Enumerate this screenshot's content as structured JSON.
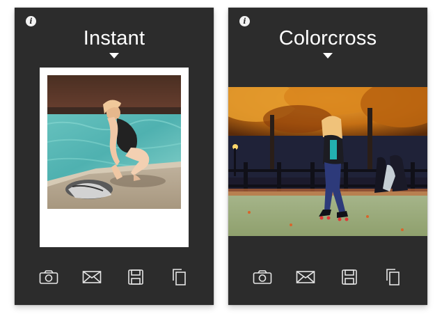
{
  "screens": [
    {
      "filter_name": "Instant",
      "info_icon": "info-icon",
      "filter_menu_icon": "caret-down-icon",
      "preview_style": "polaroid",
      "toolbar": [
        "camera-icon",
        "mail-icon",
        "save-icon",
        "copy-icon"
      ]
    },
    {
      "filter_name": "Colorcross",
      "info_icon": "info-icon",
      "filter_menu_icon": "caret-down-icon",
      "preview_style": "full-width",
      "toolbar": [
        "camera-icon",
        "mail-icon",
        "save-icon",
        "copy-icon"
      ]
    }
  ],
  "colors": {
    "app_background": "#2c2c2c",
    "page_background": "#ffffff",
    "text": "#ffffff",
    "icon_stroke": "#e6e6e6"
  }
}
